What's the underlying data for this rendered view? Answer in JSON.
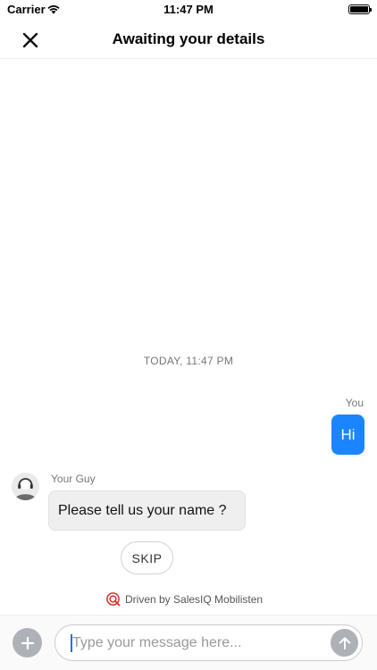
{
  "status_bar": {
    "carrier": "Carrier",
    "time": "11:47 PM",
    "battery_level": 1.0,
    "wifi_icon": "wifi-icon"
  },
  "nav": {
    "title": "Awaiting your details",
    "close_icon": "close-icon"
  },
  "conversation": {
    "timestamp": "TODAY, 11:47 PM",
    "user_message": {
      "sender": "You",
      "text": "Hi"
    },
    "agent_message": {
      "sender": "Your Guy",
      "text": "Please tell us your name ?",
      "avatar_icon": "agent-avatar-icon"
    },
    "skip_label": "SKIP"
  },
  "powered_by": {
    "text": "Driven by SalesIQ Mobilisten",
    "icon": "salesiq-logo-icon"
  },
  "composer": {
    "placeholder": "Type your message here...",
    "value": "",
    "attach_icon": "plus-icon",
    "send_icon": "arrow-up-icon"
  },
  "colors": {
    "accent": "#1a85ff",
    "bubble_agent": "#efefef",
    "button_gray": "#aeb2b8",
    "brand_red": "#d9322b"
  }
}
